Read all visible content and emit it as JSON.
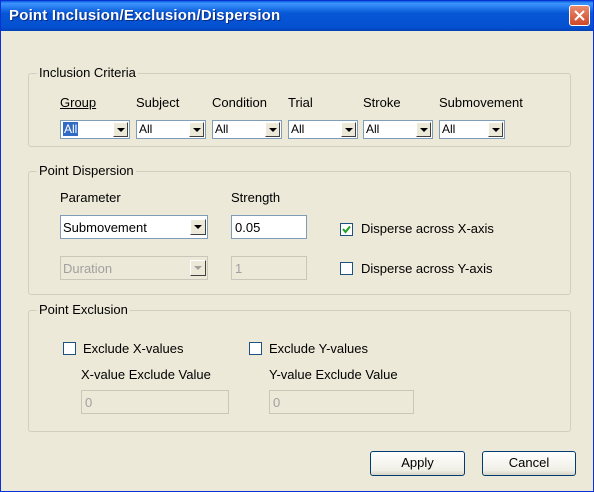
{
  "window": {
    "title": "Point Inclusion/Exclusion/Dispersion"
  },
  "inclusion": {
    "legend": "Inclusion Criteria",
    "group": {
      "label": "Group",
      "value": "All"
    },
    "subject": {
      "label": "Subject",
      "value": "All"
    },
    "condition": {
      "label": "Condition",
      "value": "All"
    },
    "trial": {
      "label": "Trial",
      "value": "All"
    },
    "stroke": {
      "label": "Stroke",
      "value": "All"
    },
    "submovement": {
      "label": "Submovement",
      "value": "All"
    }
  },
  "dispersion": {
    "legend": "Point Dispersion",
    "parameter_label": "Parameter",
    "parameter_value": "Submovement",
    "strength_label": "Strength",
    "strength_value": "0.05",
    "secondary_parameter_value": "Duration",
    "secondary_strength_value": "1",
    "x_axis_label": "Disperse across X-axis",
    "x_axis_checked": true,
    "y_axis_label": "Disperse across Y-axis",
    "y_axis_checked": false
  },
  "exclusion": {
    "legend": "Point Exclusion",
    "exclude_x_label": "Exclude X-values",
    "exclude_x_checked": false,
    "exclude_y_label": "Exclude Y-values",
    "exclude_y_checked": false,
    "x_value_label": "X-value Exclude Value",
    "x_value": "0",
    "y_value_label": "Y-value Exclude Value",
    "y_value": "0"
  },
  "buttons": {
    "apply": "Apply",
    "cancel": "Cancel"
  }
}
